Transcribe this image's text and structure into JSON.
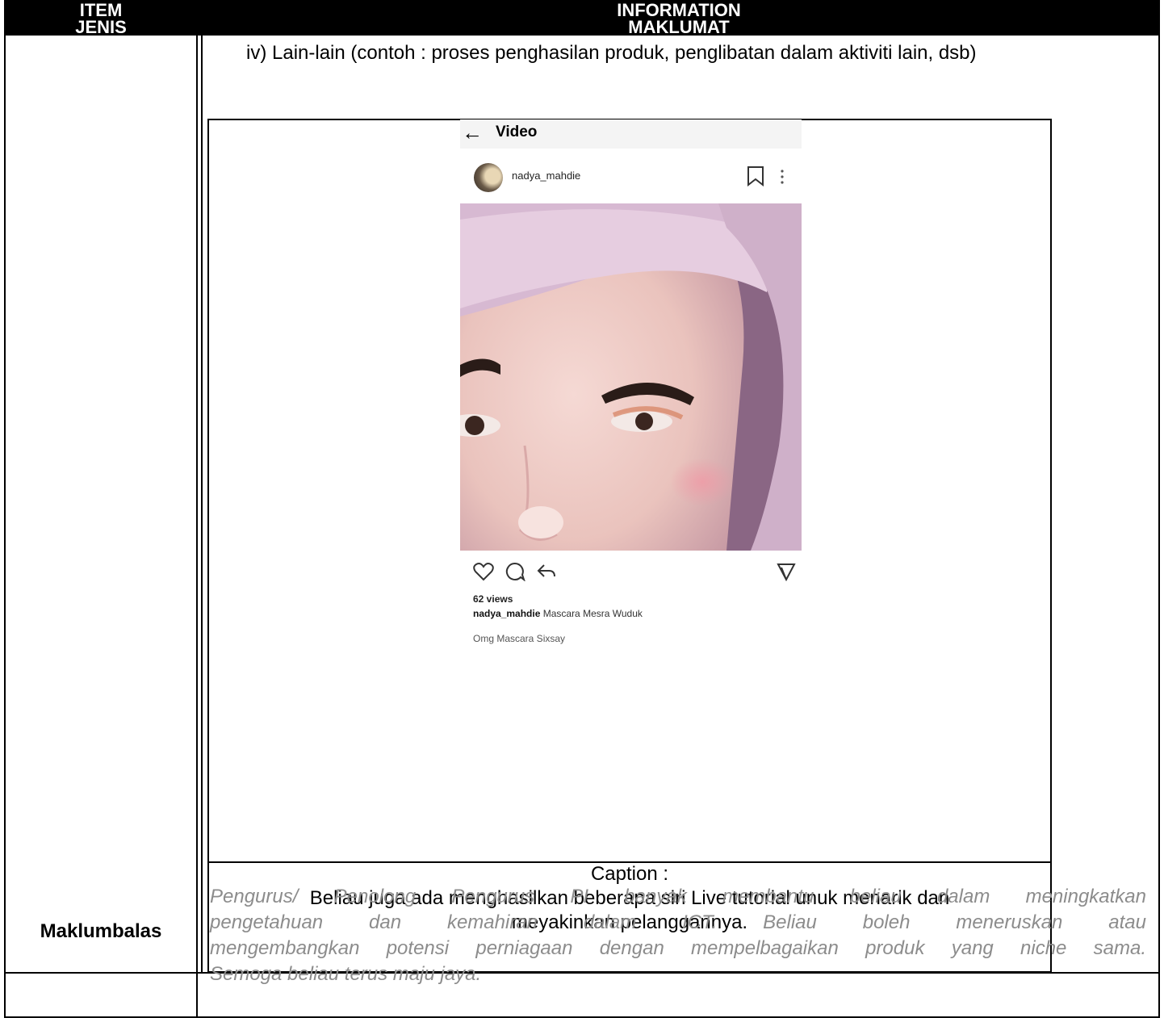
{
  "header": {
    "item_line1": "ITEM",
    "item_line2": "JENIS",
    "info_line1": "INFORMATION",
    "info_line2": "MAKLUMAT"
  },
  "content": {
    "item_text": "iv)  Lain-lain (contoh : proses penghasilan produk, penglibatan dalam aktiviti lain, dsb)",
    "caption_label": "Caption :",
    "caption_line1": "Beliau juga ada menghasilkan beberapa siri Live tutorial unuk menarik dan",
    "caption_line2": "meyakinkan pelanggannya."
  },
  "phone": {
    "title": "Video",
    "username": "nadya_mahdie",
    "views": "62 views",
    "caption_user": "nadya_mahdie",
    "caption_text": "Mascara Mesra Wuduk",
    "comment": "Omg Mascara Sixsay",
    "icons": [
      "back-arrow-icon",
      "bookmark-icon",
      "more-icon",
      "heart-icon",
      "comment-icon",
      "share-icon",
      "send-icon"
    ]
  },
  "feedback": {
    "label": "Maklumbalas",
    "line1": "Pengurus/ Penolong Pengurus PI banyak membantu beliau dalam meningkatkan",
    "line2": "pengetahuan dan kemahiran dalam ICT. Beliau boleh meneruskan atau",
    "line3": "mengembangkan potensi perniagaan dengan mempelbagaikan produk yang niche sama.",
    "line4": "Semoga beliau terus maju jaya."
  }
}
